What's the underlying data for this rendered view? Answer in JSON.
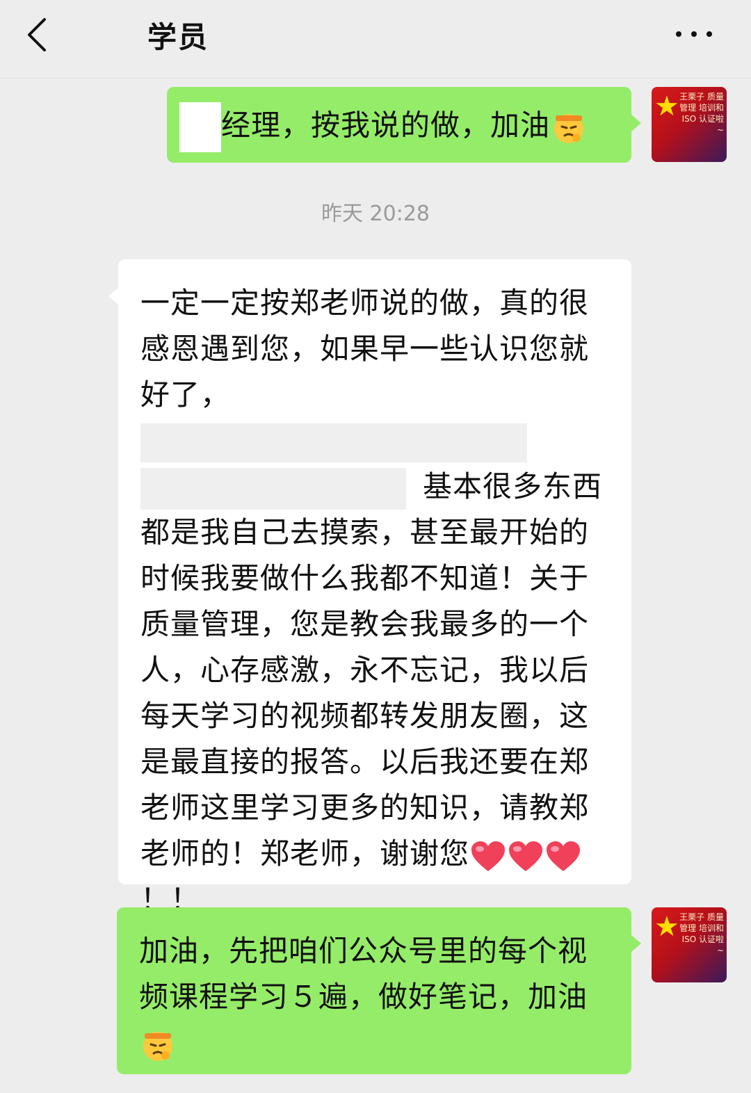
{
  "header": {
    "title": "学员",
    "back_icon": "chevron-left-icon",
    "more_icon": "more-dots-icon"
  },
  "messages": [
    {
      "side": "out",
      "text": "经理，按我说的做，加油"
    },
    {
      "timestamp": "昨天 20:28"
    },
    {
      "side": "in",
      "line1": "一定一定按郑老师说的做，真的很感恩遇到您，如果早一些认识您就好了，",
      "line2": "基本很多东西都是我自己去摸索，甚至最开始的时候我要做什么我都不知道！关于质量管理，您是教会我最多的一个人，心存感激，永不忘记，我以后每天学习的视频都转发朋友圈，这是最直接的报答。以后我还要在郑老师这里学习更多的知识，请教郑老师的！郑老师，谢谢您",
      "line3": "！！"
    },
    {
      "side": "out",
      "text": "加油，先把咱们公众号里的每个视频课程学习５遍，做好笔记，加油"
    }
  ],
  "avatar": {
    "text": "王栗子 质量管理 培训和ISO 认证啦~"
  },
  "colors": {
    "background": "#ededed",
    "bubble_out": "#95ec69",
    "bubble_in": "#ffffff",
    "timestamp": "#9a9a9a"
  }
}
